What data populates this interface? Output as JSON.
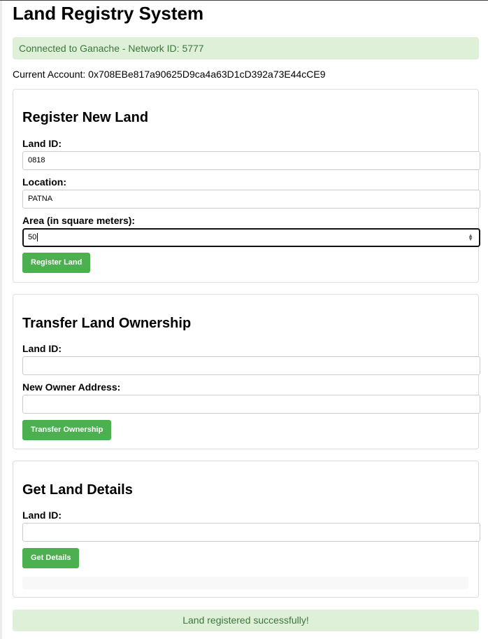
{
  "title": "Land Registry System",
  "connection_status": "Connected to Ganache - Network ID: 5777",
  "current_account": "Current Account: 0x708EBe817a90625D9ca4a63D1cD392a73E44cCE9",
  "register": {
    "heading": "Register New Land",
    "land_id_label": "Land ID:",
    "land_id_value": "0818",
    "location_label": "Location:",
    "location_value": "PATNA",
    "area_label": "Area (in square meters):",
    "area_value": "50",
    "button": "Register Land"
  },
  "transfer": {
    "heading": "Transfer Land Ownership",
    "land_id_label": "Land ID:",
    "land_id_value": "",
    "new_owner_label": "New Owner Address:",
    "new_owner_value": "",
    "button": "Transfer Ownership"
  },
  "details": {
    "heading": "Get Land Details",
    "land_id_label": "Land ID:",
    "land_id_value": "",
    "button": "Get Details",
    "result": ""
  },
  "status_message": "Land registered successfully!",
  "colors": {
    "accent": "#4caf50",
    "alert_bg": "#dff0d8",
    "alert_text": "#3c763d"
  }
}
